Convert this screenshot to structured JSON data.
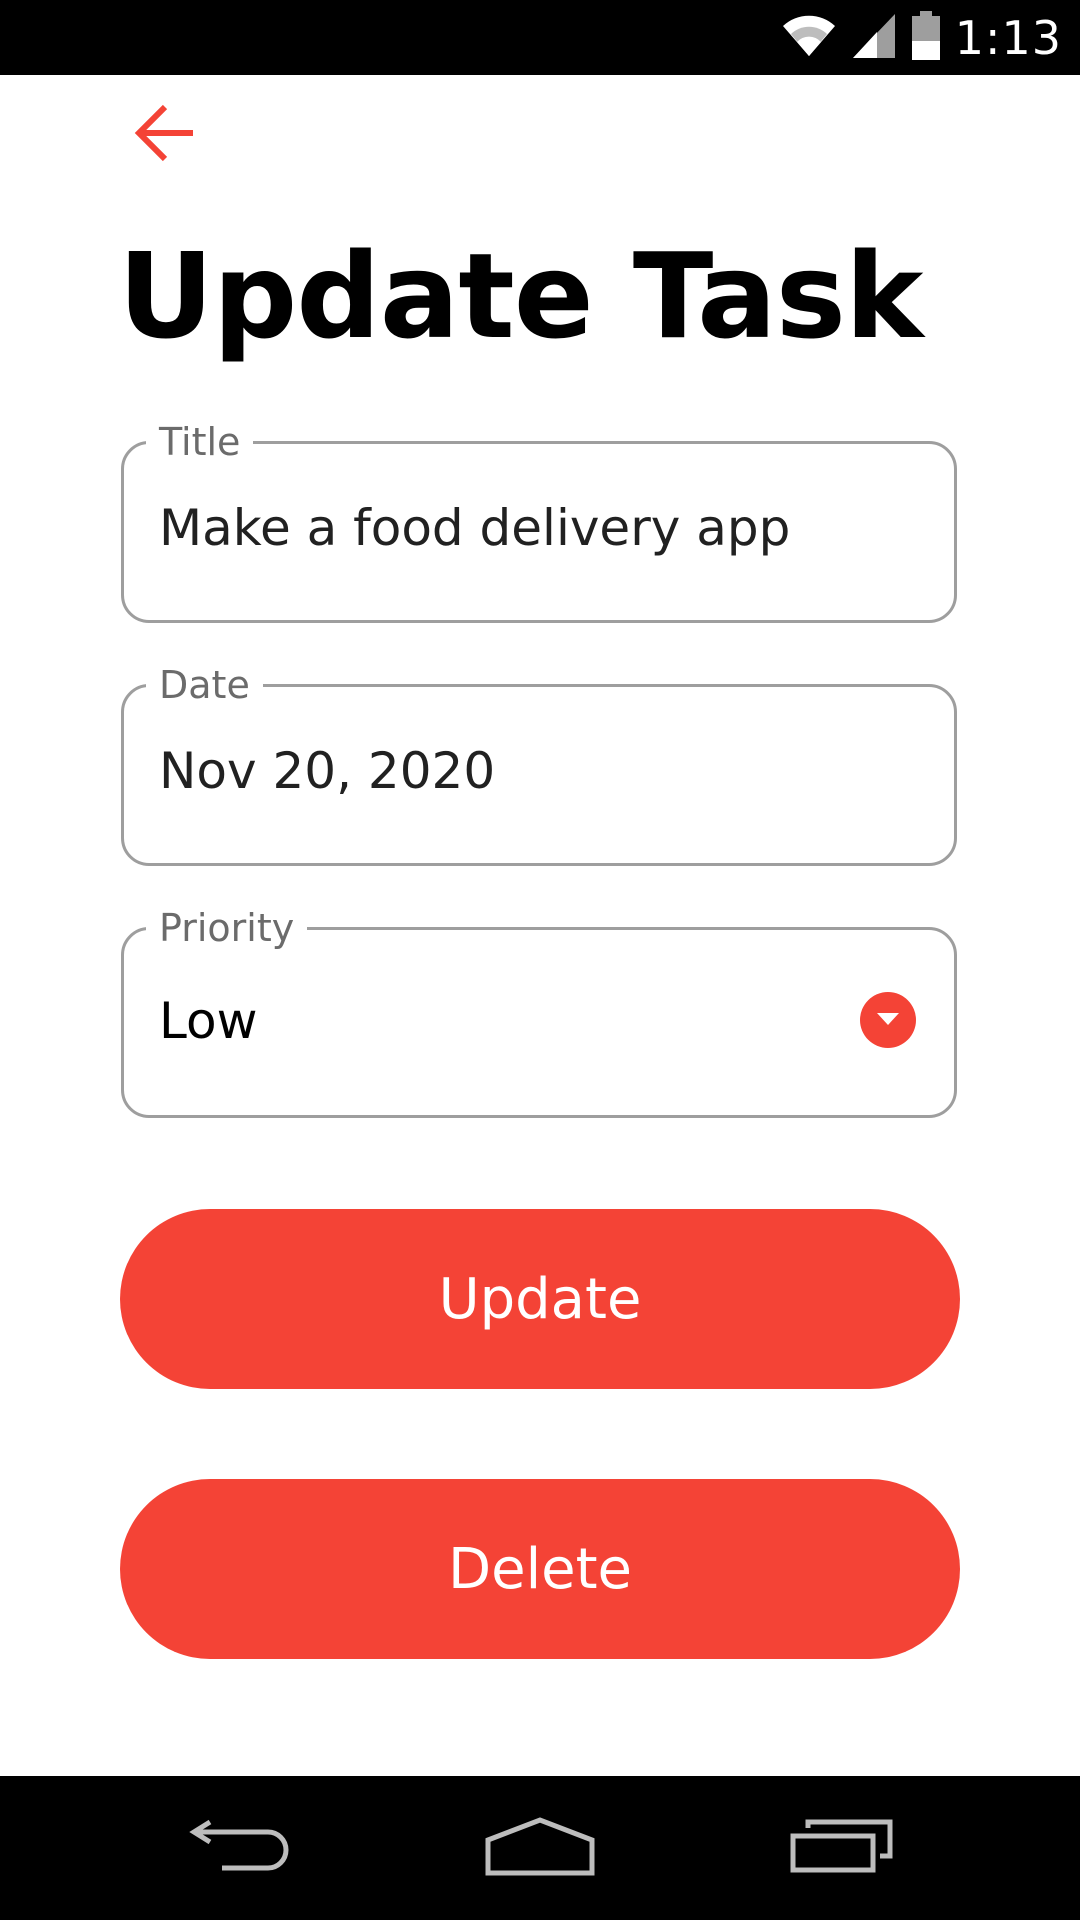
{
  "status_bar": {
    "time": "1:13",
    "icons": [
      "wifi-icon",
      "signal-icon",
      "battery-icon"
    ]
  },
  "header": {
    "back_icon": "arrow-left-icon",
    "title": "Update Task"
  },
  "form": {
    "title_field": {
      "label": "Title",
      "value": "Make a food delivery app"
    },
    "date_field": {
      "label": "Date",
      "value": "Nov 20, 2020"
    },
    "priority_field": {
      "label": "Priority",
      "value": "Low",
      "icon": "dropdown-circle-icon"
    }
  },
  "actions": {
    "update_label": "Update",
    "delete_label": "Delete"
  },
  "nav_bar": {
    "icons": [
      "nav-back-icon",
      "nav-home-icon",
      "nav-recents-icon"
    ]
  },
  "colors": {
    "accent": "#f44336",
    "field_border": "#9e9e9e",
    "label": "#6b6b6b",
    "text": "#212121"
  }
}
